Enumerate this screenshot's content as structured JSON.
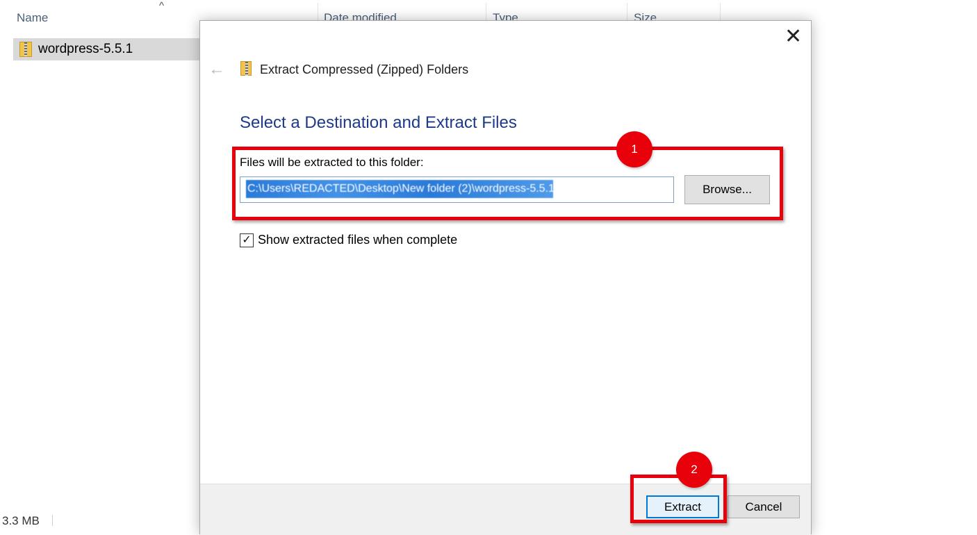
{
  "explorer": {
    "columns": {
      "name": "Name",
      "date_modified": "Date modified",
      "type": "Type",
      "size": "Size"
    },
    "sort_indicator": "^",
    "file": {
      "name": "wordpress-5.5.1",
      "icon": "zip-folder-icon"
    },
    "status_bar": {
      "size": "3.3 MB"
    }
  },
  "dialog": {
    "close_glyph": "✕",
    "back_glyph": "←",
    "title": "Extract Compressed (Zipped) Folders",
    "heading": "Select a Destination and Extract Files",
    "destination_label": "Files will be extracted to this folder:",
    "destination_value": "C:\\Users\\REDACTED\\Desktop\\New folder (2)\\wordpress-5.5.1",
    "browse_label": "Browse...",
    "checkbox": {
      "label": "Show extracted files when complete",
      "checked": true,
      "glyph": "✓"
    },
    "extract_label": "Extract",
    "cancel_label": "Cancel"
  },
  "annotations": {
    "step1": "1",
    "step2": "2",
    "color": "#e8000a"
  }
}
